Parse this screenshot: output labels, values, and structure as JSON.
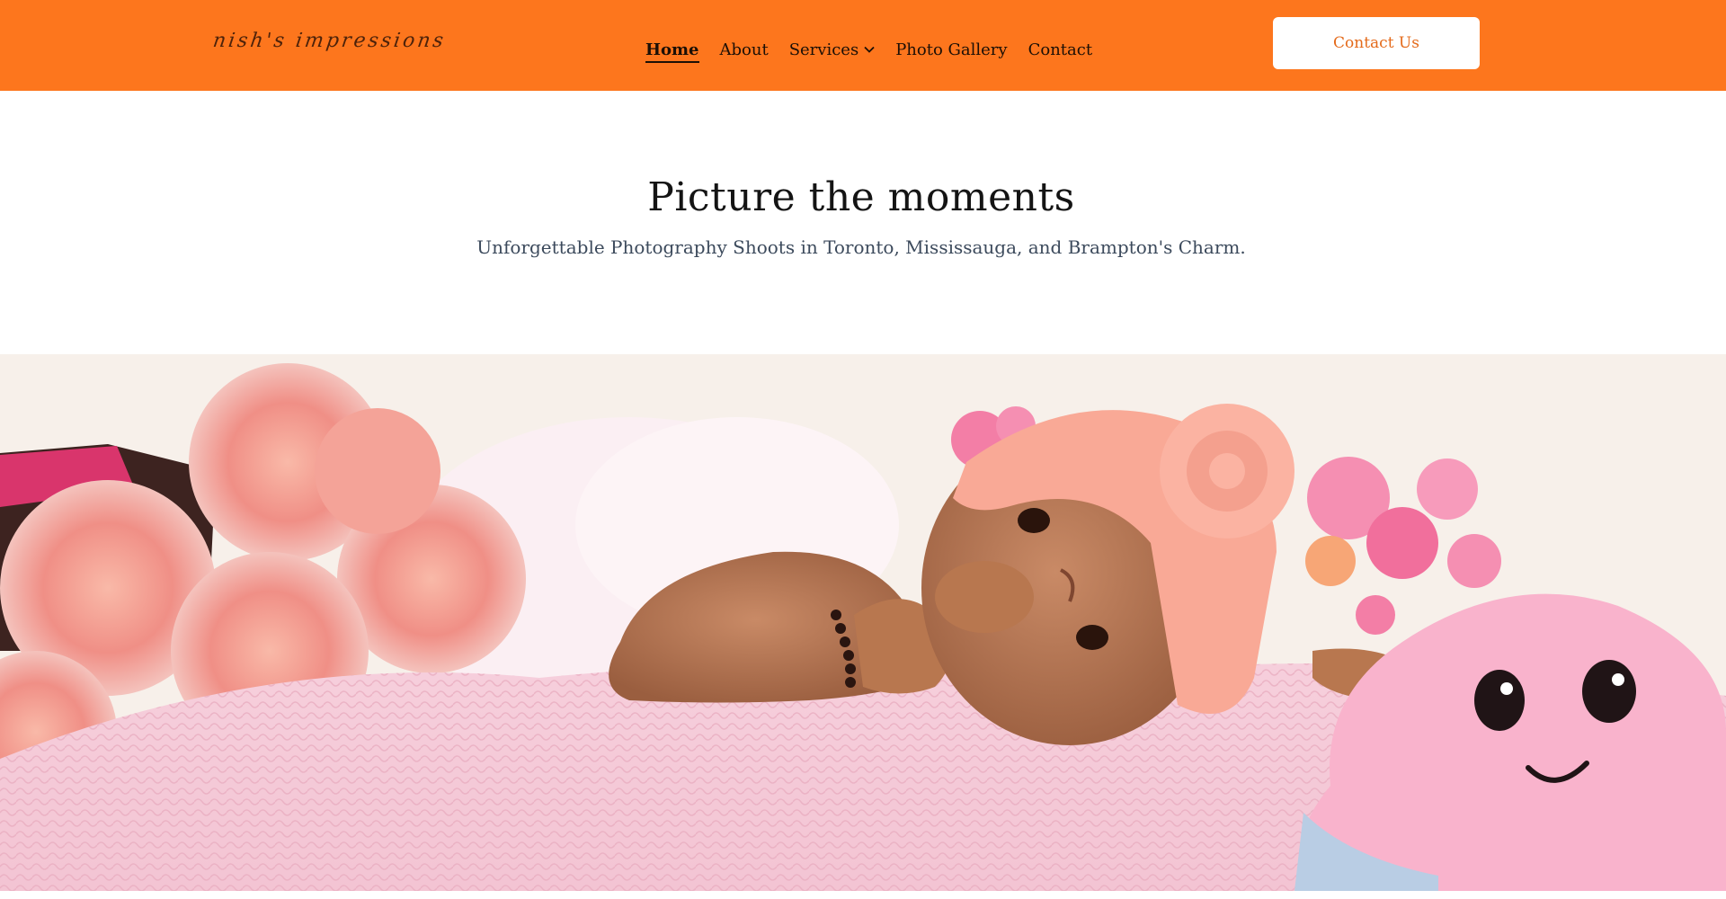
{
  "header": {
    "logo": {
      "text": "nish's impressions",
      "icon": "camera-icon"
    },
    "nav": [
      {
        "label": "Home",
        "active": true
      },
      {
        "label": "About",
        "active": false
      },
      {
        "label": "Services",
        "active": false,
        "has_dropdown": true,
        "dropdown_icon": "chevron-down-icon"
      },
      {
        "label": "Photo Gallery",
        "active": false
      },
      {
        "label": "Contact",
        "active": false
      }
    ],
    "cta_label": "Contact Us"
  },
  "hero": {
    "title": "Picture the moments",
    "subtitle": "Unforgettable Photography Shoots in Toronto, Mississauga, and Brampton's Charm."
  },
  "colors": {
    "header_bg": "#fd761d",
    "cta_text": "#e46a1a",
    "subtitle_text": "#3c4a5c",
    "image_bg": "#f6efea"
  }
}
